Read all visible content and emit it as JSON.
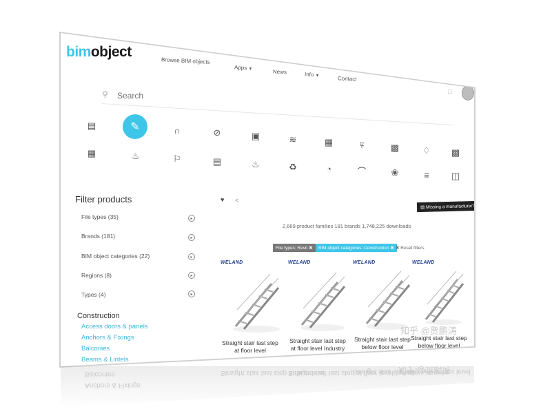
{
  "logo": {
    "part1": "bim",
    "part2": "object"
  },
  "nav": {
    "browse": "Browse BIM objects",
    "apps": "Apps",
    "news": "News",
    "info": "Info",
    "contact": "Contact"
  },
  "search": {
    "placeholder": "Search"
  },
  "categories": {
    "row1": [
      "doors-icon",
      "pencil-icon",
      "profile-icon",
      "plug-icon",
      "radiator-icon",
      "heater-icon",
      "grille-icon",
      "shower-head-icon",
      "panel-icon",
      "chair-icon",
      "computer-icon"
    ],
    "row2": [
      "wall-icon",
      "garden-icon",
      "lamp-icon",
      "cabinet-icon",
      "fire-icon",
      "faucet-icon",
      "bathtub-icon",
      "stairs-icon",
      "fan-icon",
      "shelf-icon",
      "door-icon"
    ],
    "active": "pencil-icon"
  },
  "sidebar": {
    "title": "Filter products",
    "filters": [
      {
        "label": "File types (35)"
      },
      {
        "label": "Brands (181)"
      },
      {
        "label": "BIM object categories (22)"
      },
      {
        "label": "Regions (8)"
      },
      {
        "label": "Types (4)"
      }
    ],
    "section_title": "Construction",
    "links": [
      "Access doors & panels",
      "Anchors & Fixings",
      "Balconies",
      "Beams & Lintels"
    ]
  },
  "toolbar": {
    "missing_label": "Missing a manufacturer?"
  },
  "stats": {
    "text": "2,669  product families  181  brands  1,748,225  downloads"
  },
  "active_filters": {
    "chip1": "File types: Revit",
    "chip2": "BIM object categories: Construction",
    "reset": "Reset filters"
  },
  "products": [
    {
      "brand": "WELAND",
      "title": "Straight stair last step at floor level"
    },
    {
      "brand": "WELAND",
      "title": "Straight stair last step at floor level Industry"
    },
    {
      "brand": "WELAND",
      "title": "Straight stair last step below floor level"
    },
    {
      "brand": "WELAND",
      "title": "Straight stair last step below floor level"
    }
  ],
  "watermark": {
    "text": "知乎 @贾鹏涛"
  },
  "colors": {
    "accent": "#3ec6e9",
    "brand_blue": "#1e3c8c"
  }
}
